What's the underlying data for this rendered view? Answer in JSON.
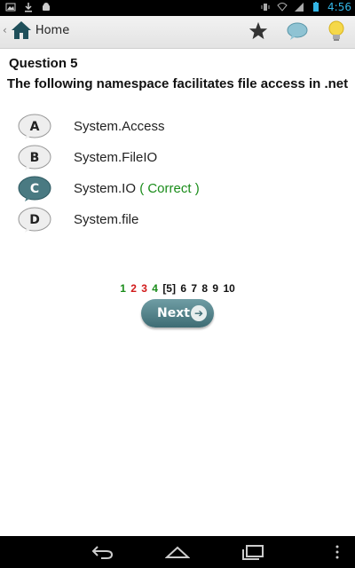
{
  "statusbar": {
    "time": "4:56"
  },
  "actionbar": {
    "home_label": "Home",
    "icons": [
      "star-icon",
      "chat-bubble-icon",
      "lightbulb-icon"
    ]
  },
  "question": {
    "number_label": "Question 5",
    "text": "The following namespace facilitates file access in .net"
  },
  "options": [
    {
      "letter": "A",
      "text": "System.Access",
      "note": "",
      "selected": false
    },
    {
      "letter": "B",
      "text": "System.FileIO",
      "note": "",
      "selected": false
    },
    {
      "letter": "C",
      "text": "System.IO",
      "note": "( Correct )",
      "selected": true
    },
    {
      "letter": "D",
      "text": "System.file",
      "note": "",
      "selected": false
    }
  ],
  "pagination": {
    "pages": [
      {
        "label": "1",
        "status": "correct"
      },
      {
        "label": "2",
        "status": "wrong"
      },
      {
        "label": "3",
        "status": "wrong"
      },
      {
        "label": "4",
        "status": "correct"
      },
      {
        "label": "[5]",
        "status": "current"
      },
      {
        "label": "6",
        "status": "unanswered"
      },
      {
        "label": "7",
        "status": "unanswered"
      },
      {
        "label": "8",
        "status": "unanswered"
      },
      {
        "label": "9",
        "status": "unanswered"
      },
      {
        "label": "10",
        "status": "unanswered"
      }
    ]
  },
  "next_button": {
    "label": "Next"
  },
  "colors": {
    "correct": "#1a8c1a",
    "wrong": "#d11a1a",
    "accent": "#4a7a82"
  }
}
